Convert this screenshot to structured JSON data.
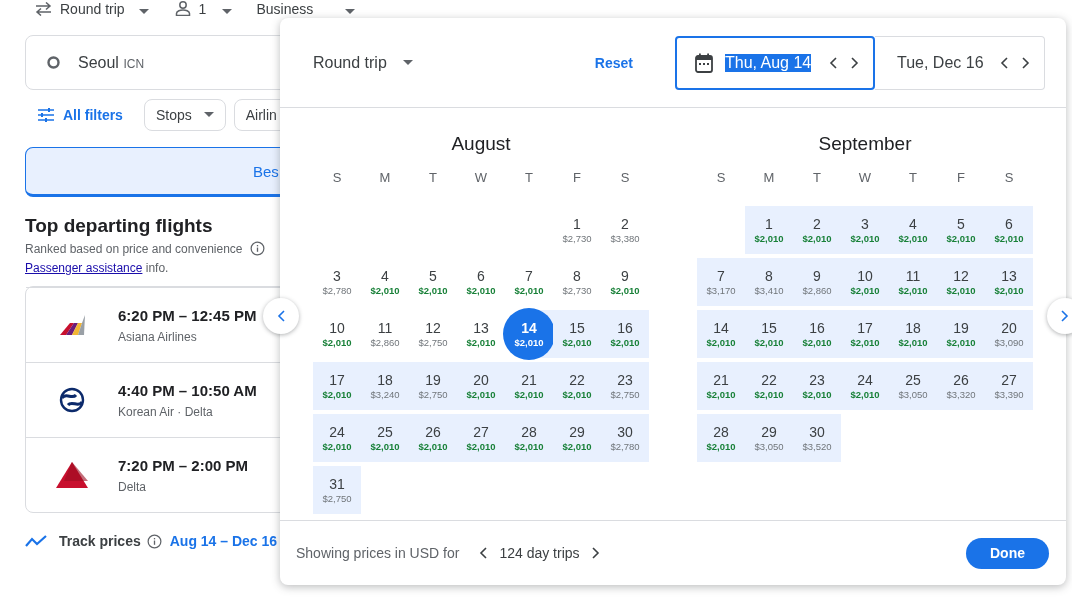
{
  "top_bar": {
    "trip_type": "Round trip",
    "passengers": "1",
    "cabin": "Business"
  },
  "search": {
    "origin": "Seoul",
    "origin_code": "ICN"
  },
  "filters": {
    "all_filters": "All filters",
    "chips": [
      {
        "label": "Stops",
        "caret": true
      },
      {
        "label": "Airlin",
        "caret": false
      }
    ]
  },
  "sort_tab": {
    "label": "Bes",
    "selected": true
  },
  "results": {
    "title": "Top departing flights",
    "subtitle": "Ranked based on price and convenience",
    "assist_link": "Passenger assistance",
    "assist_suffix": "info.",
    "flights": [
      {
        "times": "6:20 PM – 12:45 PM",
        "airlines": "Asiana Airlines",
        "kind": "stripes"
      },
      {
        "times": "4:40 PM – 10:50 AM",
        "airlines": "Korean Air · Delta",
        "kind": "swirl"
      },
      {
        "times": "7:20 PM – 2:00 PM",
        "airlines": "Delta",
        "kind": "triangle"
      }
    ]
  },
  "track": {
    "label": "Track prices",
    "dates": "Aug 14 – Dec 16"
  },
  "date_picker": {
    "trip_type": "Round trip",
    "reset": "Reset",
    "departure": {
      "value": "Thu, Aug 14",
      "active": true,
      "text_selected": true
    },
    "return": {
      "value": "Tue, Dec 16",
      "active": false,
      "text_selected": false
    },
    "months": [
      {
        "name": "August",
        "weekdays": [
          "S",
          "M",
          "T",
          "W",
          "T",
          "F",
          "S"
        ],
        "weeks": [
          [
            {
              "day": "1",
              "price": "$2,730",
              "cheap": false,
              "in_range": false,
              "selected": false
            },
            {
              "day": "2",
              "price": "$3,380",
              "cheap": false,
              "in_range": false,
              "selected": false
            }
          ],
          [
            {
              "day": "3",
              "price": "$2,780",
              "cheap": false,
              "in_range": false,
              "selected": false
            },
            {
              "day": "4",
              "price": "$2,010",
              "cheap": true,
              "in_range": false,
              "selected": false
            },
            {
              "day": "5",
              "price": "$2,010",
              "cheap": true,
              "in_range": false,
              "selected": false
            },
            {
              "day": "6",
              "price": "$2,010",
              "cheap": true,
              "in_range": false,
              "selected": false
            },
            {
              "day": "7",
              "price": "$2,010",
              "cheap": true,
              "in_range": false,
              "selected": false
            },
            {
              "day": "8",
              "price": "$2,730",
              "cheap": false,
              "in_range": false,
              "selected": false
            },
            {
              "day": "9",
              "price": "$2,010",
              "cheap": true,
              "in_range": false,
              "selected": false
            }
          ],
          [
            {
              "day": "10",
              "price": "$2,010",
              "cheap": true,
              "in_range": false,
              "selected": false
            },
            {
              "day": "11",
              "price": "$2,860",
              "cheap": false,
              "in_range": false,
              "selected": false
            },
            {
              "day": "12",
              "price": "$2,750",
              "cheap": false,
              "in_range": false,
              "selected": false
            },
            {
              "day": "13",
              "price": "$2,010",
              "cheap": true,
              "in_range": false,
              "selected": false
            },
            {
              "day": "14",
              "price": "$2,010",
              "cheap": true,
              "in_range": true,
              "selected": true
            },
            {
              "day": "15",
              "price": "$2,010",
              "cheap": true,
              "in_range": true,
              "selected": false
            },
            {
              "day": "16",
              "price": "$2,010",
              "cheap": true,
              "in_range": true,
              "selected": false
            }
          ],
          [
            {
              "day": "17",
              "price": "$2,010",
              "cheap": true,
              "in_range": true,
              "selected": false
            },
            {
              "day": "18",
              "price": "$3,240",
              "cheap": false,
              "in_range": true,
              "selected": false
            },
            {
              "day": "19",
              "price": "$2,750",
              "cheap": false,
              "in_range": true,
              "selected": false
            },
            {
              "day": "20",
              "price": "$2,010",
              "cheap": true,
              "in_range": true,
              "selected": false
            },
            {
              "day": "21",
              "price": "$2,010",
              "cheap": true,
              "in_range": true,
              "selected": false
            },
            {
              "day": "22",
              "price": "$2,010",
              "cheap": true,
              "in_range": true,
              "selected": false
            },
            {
              "day": "23",
              "price": "$2,750",
              "cheap": false,
              "in_range": true,
              "selected": false
            }
          ],
          [
            {
              "day": "24",
              "price": "$2,010",
              "cheap": true,
              "in_range": true,
              "selected": false
            },
            {
              "day": "25",
              "price": "$2,010",
              "cheap": true,
              "in_range": true,
              "selected": false
            },
            {
              "day": "26",
              "price": "$2,010",
              "cheap": true,
              "in_range": true,
              "selected": false
            },
            {
              "day": "27",
              "price": "$2,010",
              "cheap": true,
              "in_range": true,
              "selected": false
            },
            {
              "day": "28",
              "price": "$2,010",
              "cheap": true,
              "in_range": true,
              "selected": false
            },
            {
              "day": "29",
              "price": "$2,010",
              "cheap": true,
              "in_range": true,
              "selected": false
            },
            {
              "day": "30",
              "price": "$2,780",
              "cheap": false,
              "in_range": true,
              "selected": false
            }
          ],
          [
            {
              "day": "31",
              "price": "$2,750",
              "cheap": false,
              "in_range": true,
              "selected": false
            }
          ]
        ]
      },
      {
        "name": "September",
        "weekdays": [
          "S",
          "M",
          "T",
          "W",
          "T",
          "F",
          "S"
        ],
        "weeks": [
          [
            {
              "day": "1",
              "price": "$2,010",
              "cheap": true,
              "in_range": true,
              "selected": false
            },
            {
              "day": "2",
              "price": "$2,010",
              "cheap": true,
              "in_range": true,
              "selected": false
            },
            {
              "day": "3",
              "price": "$2,010",
              "cheap": true,
              "in_range": true,
              "selected": false
            },
            {
              "day": "4",
              "price": "$2,010",
              "cheap": true,
              "in_range": true,
              "selected": false
            },
            {
              "day": "5",
              "price": "$2,010",
              "cheap": true,
              "in_range": true,
              "selected": false
            },
            {
              "day": "6",
              "price": "$2,010",
              "cheap": true,
              "in_range": true,
              "selected": false
            }
          ],
          [
            {
              "day": "7",
              "price": "$3,170",
              "cheap": false,
              "in_range": true,
              "selected": false
            },
            {
              "day": "8",
              "price": "$3,410",
              "cheap": false,
              "in_range": true,
              "selected": false
            },
            {
              "day": "9",
              "price": "$2,860",
              "cheap": false,
              "in_range": true,
              "selected": false
            },
            {
              "day": "10",
              "price": "$2,010",
              "cheap": true,
              "in_range": true,
              "selected": false
            },
            {
              "day": "11",
              "price": "$2,010",
              "cheap": true,
              "in_range": true,
              "selected": false
            },
            {
              "day": "12",
              "price": "$2,010",
              "cheap": true,
              "in_range": true,
              "selected": false
            },
            {
              "day": "13",
              "price": "$2,010",
              "cheap": true,
              "in_range": true,
              "selected": false
            }
          ],
          [
            {
              "day": "14",
              "price": "$2,010",
              "cheap": true,
              "in_range": true,
              "selected": false
            },
            {
              "day": "15",
              "price": "$2,010",
              "cheap": true,
              "in_range": true,
              "selected": false
            },
            {
              "day": "16",
              "price": "$2,010",
              "cheap": true,
              "in_range": true,
              "selected": false
            },
            {
              "day": "17",
              "price": "$2,010",
              "cheap": true,
              "in_range": true,
              "selected": false
            },
            {
              "day": "18",
              "price": "$2,010",
              "cheap": true,
              "in_range": true,
              "selected": false
            },
            {
              "day": "19",
              "price": "$2,010",
              "cheap": true,
              "in_range": true,
              "selected": false
            },
            {
              "day": "20",
              "price": "$3,090",
              "cheap": false,
              "in_range": true,
              "selected": false
            }
          ],
          [
            {
              "day": "21",
              "price": "$2,010",
              "cheap": true,
              "in_range": true,
              "selected": false
            },
            {
              "day": "22",
              "price": "$2,010",
              "cheap": true,
              "in_range": true,
              "selected": false
            },
            {
              "day": "23",
              "price": "$2,010",
              "cheap": true,
              "in_range": true,
              "selected": false
            },
            {
              "day": "24",
              "price": "$2,010",
              "cheap": true,
              "in_range": true,
              "selected": false
            },
            {
              "day": "25",
              "price": "$3,050",
              "cheap": false,
              "in_range": true,
              "selected": false
            },
            {
              "day": "26",
              "price": "$3,320",
              "cheap": false,
              "in_range": true,
              "selected": false
            },
            {
              "day": "27",
              "price": "$3,390",
              "cheap": false,
              "in_range": true,
              "selected": false
            }
          ],
          [
            {
              "day": "28",
              "price": "$2,010",
              "cheap": true,
              "in_range": true,
              "selected": false
            },
            {
              "day": "29",
              "price": "$3,050",
              "cheap": false,
              "in_range": true,
              "selected": false
            },
            {
              "day": "30",
              "price": "$3,520",
              "cheap": false,
              "in_range": true,
              "selected": false
            }
          ]
        ]
      }
    ],
    "footer": {
      "note": "Showing prices in USD for",
      "trip_length": "124 day trips"
    },
    "done": "Done"
  }
}
